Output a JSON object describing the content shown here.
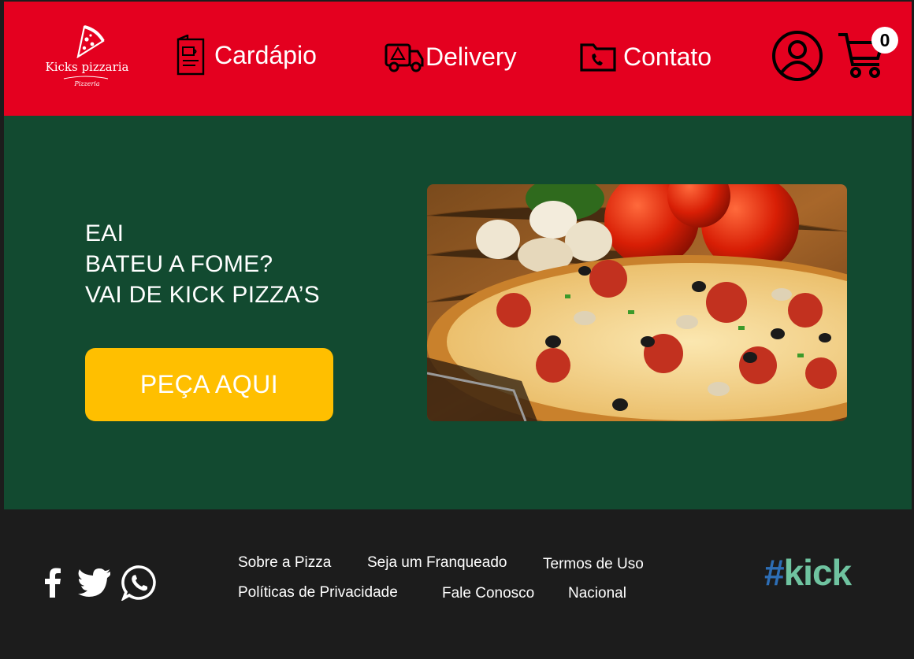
{
  "colors": {
    "header": "#e4001f",
    "hero": "#124a30",
    "footer": "#1c1c1c",
    "button": "#ffbf00",
    "brand_hash": "#2d6eb6",
    "brand_word": "#6fc3a0"
  },
  "logo": {
    "name": "Kicks pizzaria",
    "subtitle": "Pizzeria",
    "icon": "pizza-slice-icon"
  },
  "nav": [
    {
      "label": "Cardápio",
      "icon": "menu-card-icon"
    },
    {
      "label": "Delivery",
      "icon": "delivery-truck-icon"
    },
    {
      "label": "Contato",
      "icon": "phone-folder-icon"
    }
  ],
  "header_actions": {
    "user_icon": "user-icon",
    "cart_icon": "cart-icon",
    "cart_count": "0"
  },
  "hero": {
    "lines": [
      "EAI",
      "BATEU A FOME?",
      "VAI DE KICK PIZZA’S"
    ],
    "cta_label": "PEÇA AQUI",
    "image": "pizza-photo"
  },
  "footer": {
    "social": [
      "facebook-icon",
      "twitter-icon",
      "whatsapp-icon"
    ],
    "links": [
      "Sobre a Pizza",
      "Seja um Franqueado",
      "Termos de Uso",
      "Políticas de Privacidade",
      "Fale Conosco",
      "Nacional"
    ],
    "brand_hash": "#",
    "brand_word": "kick"
  }
}
